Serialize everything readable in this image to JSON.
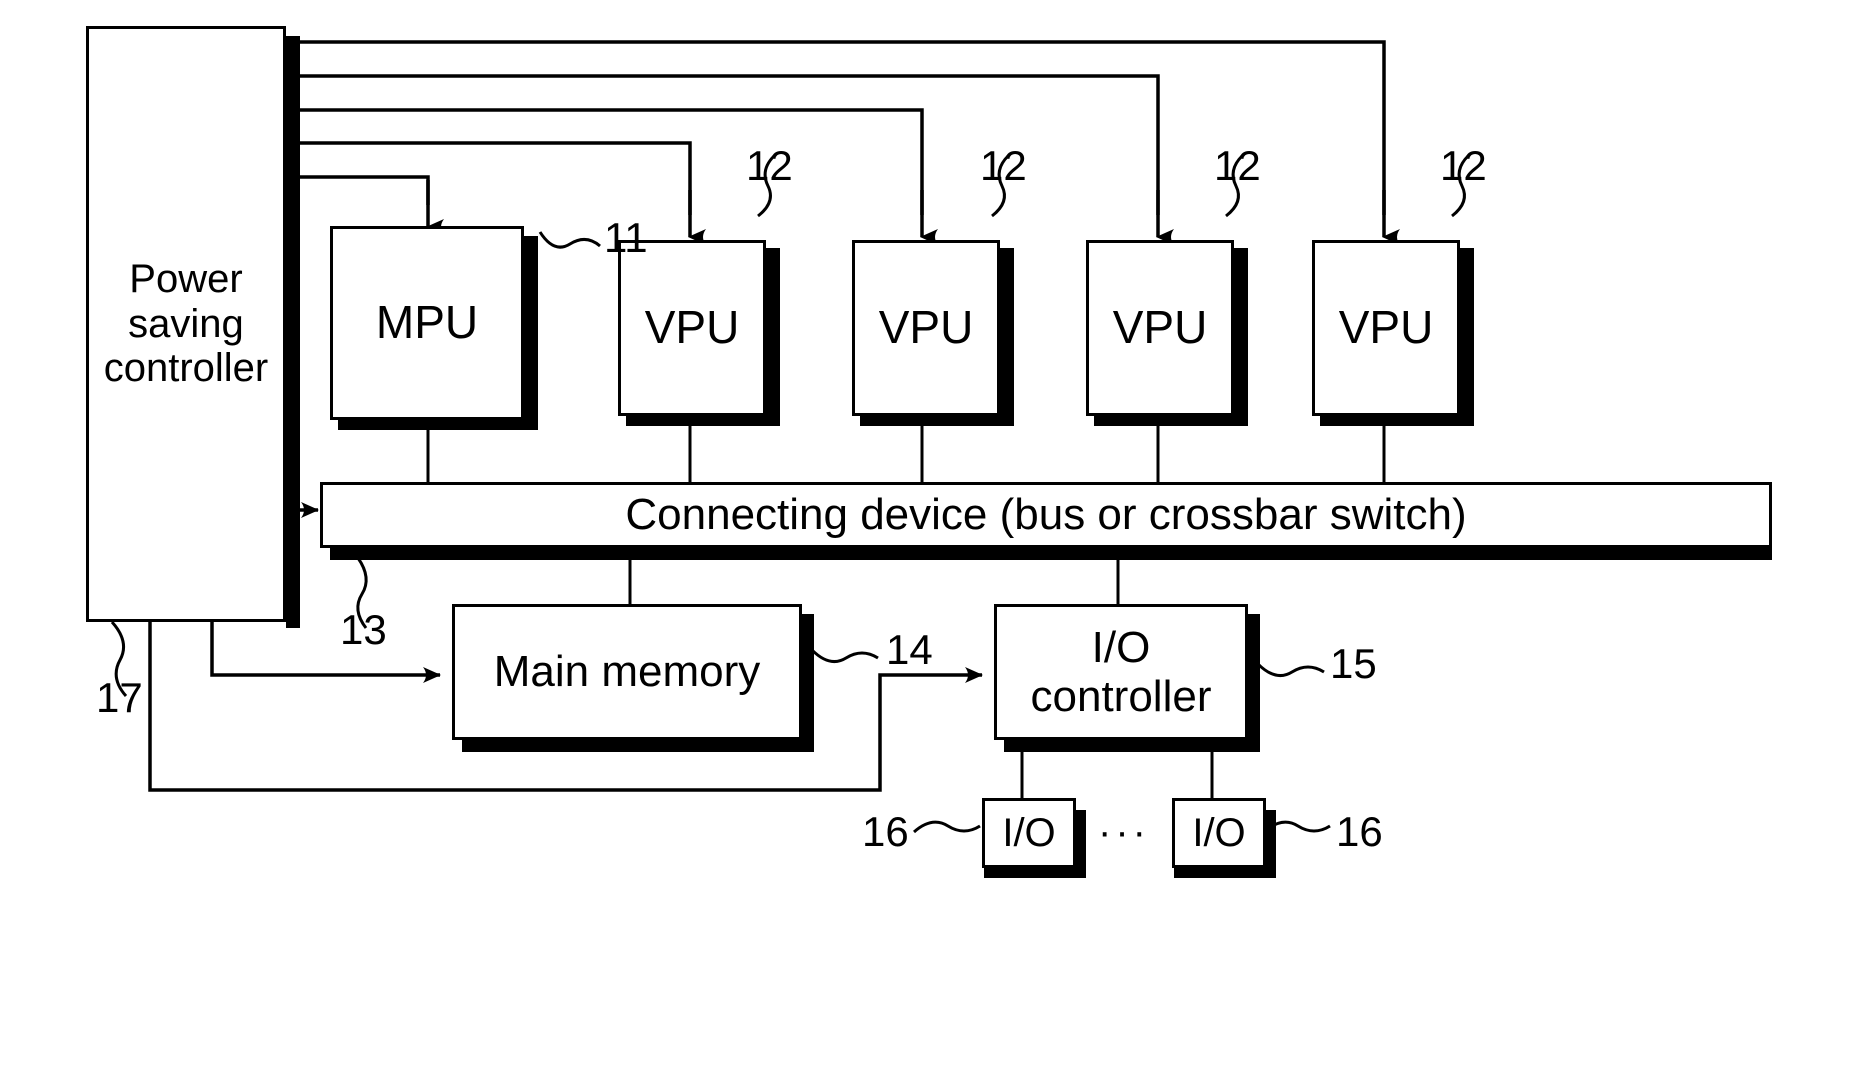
{
  "figure": {
    "type": "patent-block-diagram",
    "blocks": {
      "power_saving_controller": {
        "label": "Power\nsaving\ncontroller",
        "ref": "17"
      },
      "mpu": {
        "label": "MPU",
        "ref": "11"
      },
      "vpu_1": {
        "label": "VPU",
        "ref": "12"
      },
      "vpu_2": {
        "label": "VPU",
        "ref": "12"
      },
      "vpu_3": {
        "label": "VPU",
        "ref": "12"
      },
      "vpu_4": {
        "label": "VPU",
        "ref": "12"
      },
      "connecting_device": {
        "label": "Connecting  device  (bus  or  crossbar  switch)",
        "ref": "13"
      },
      "main_memory": {
        "label": "Main  memory",
        "ref": "14"
      },
      "io_controller": {
        "label": "I/O\ncontroller",
        "ref": "15"
      },
      "io_left": {
        "label": "I/O",
        "ref": "16"
      },
      "io_right": {
        "label": "I/O",
        "ref": "16"
      },
      "io_ellipsis": {
        "label": "···"
      }
    },
    "reference_numerals": {
      "mpu": "11",
      "vpu_a": "12",
      "vpu_b": "12",
      "vpu_c": "12",
      "vpu_d": "12",
      "connecting_device": "13",
      "main_memory": "14",
      "io_controller": "15",
      "io_left": "16",
      "io_right": "16",
      "power_saving_controller": "17"
    },
    "colors": {
      "ink": "#000000",
      "paper": "#ffffff"
    }
  }
}
